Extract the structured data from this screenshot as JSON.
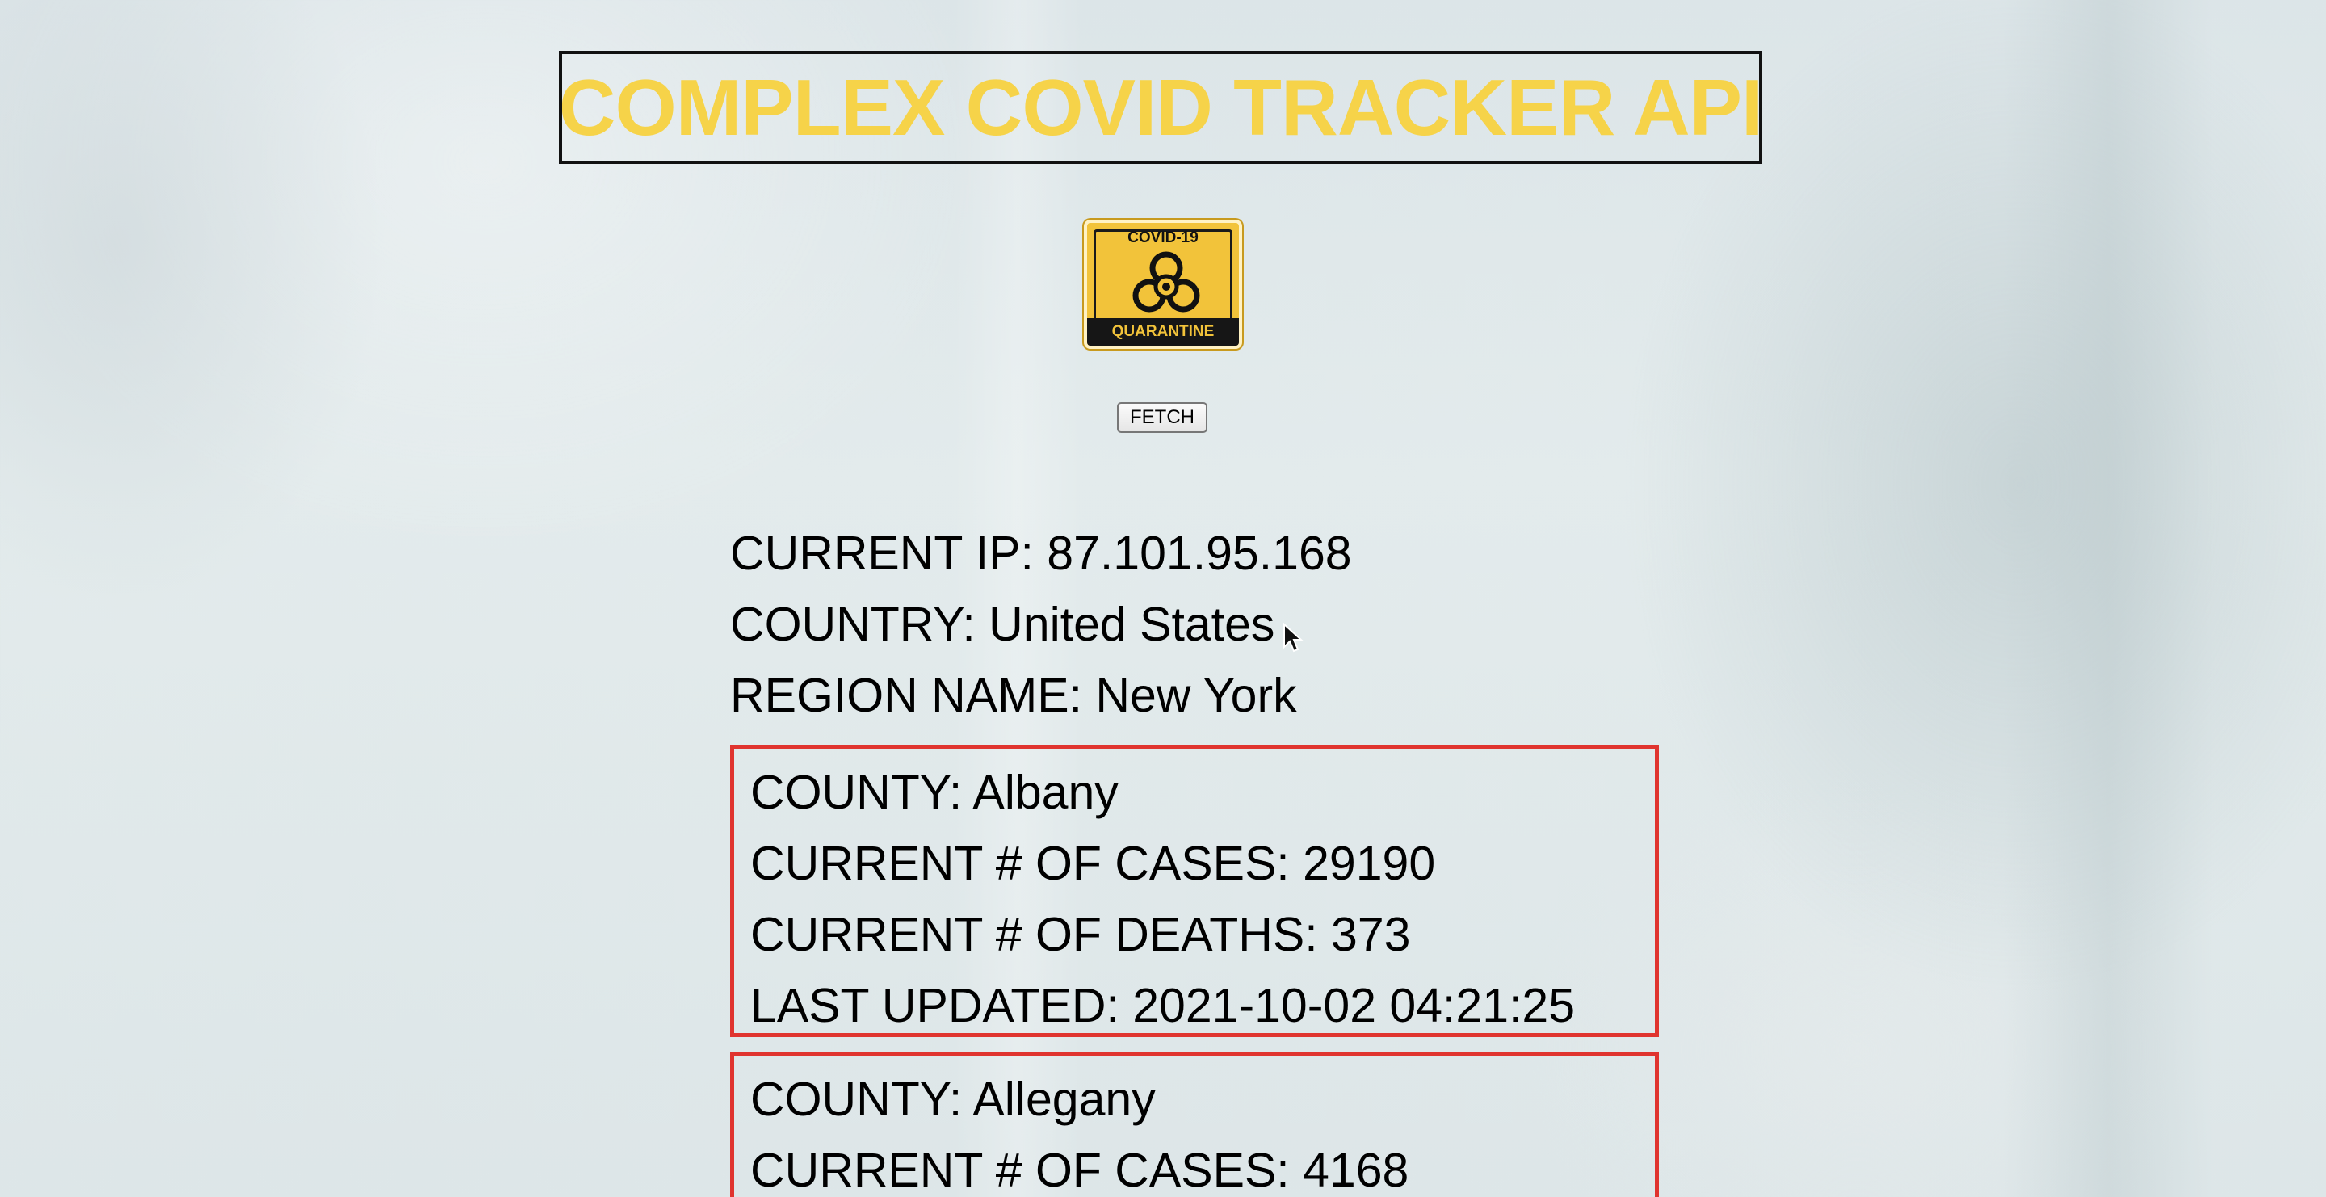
{
  "header": {
    "title": "COMPLEX COVID TRACKER API"
  },
  "logo": {
    "top_text": "COVID-19",
    "bottom_text": "QUARANTINE",
    "icon": "biohazard-icon"
  },
  "controls": {
    "fetch_label": "FETCH"
  },
  "location": {
    "ip_line": "CURRENT IP: 87.101.95.168",
    "country_line": "COUNTRY: United States",
    "region_line": "REGION NAME: New York"
  },
  "counties": [
    {
      "county": "COUNTY: Albany",
      "cases": "CURRENT # OF CASES: 29190",
      "deaths": "CURRENT # OF DEATHS: 373",
      "updated": "LAST UPDATED: 2021-10-02 04:21:25"
    },
    {
      "county": "COUNTY: Allegany",
      "cases": "CURRENT # OF CASES: 4168"
    }
  ],
  "colors": {
    "title_yellow": "#f6d349",
    "county_border": "#e0342f",
    "logo_yellow": "#f2c33a"
  }
}
